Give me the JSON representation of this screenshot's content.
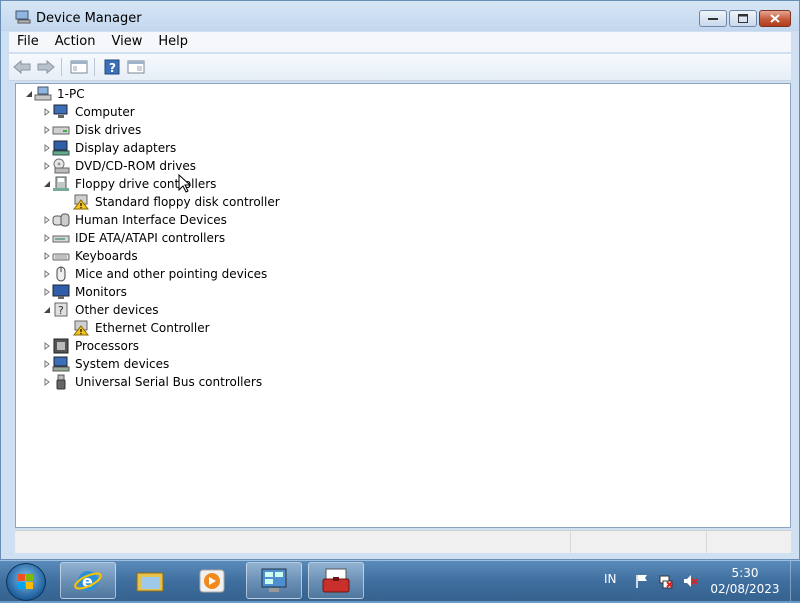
{
  "window": {
    "title": "Device Manager"
  },
  "menu": [
    "File",
    "Action",
    "View",
    "Help"
  ],
  "tree": {
    "root": "1-PC",
    "items": [
      {
        "label": "Computer",
        "icon": "computer-icon",
        "expanded": false
      },
      {
        "label": "Disk drives",
        "icon": "disk-drive-icon",
        "expanded": false
      },
      {
        "label": "Display adapters",
        "icon": "display-adapter-icon",
        "expanded": false
      },
      {
        "label": "DVD/CD-ROM drives",
        "icon": "dvd-drive-icon",
        "expanded": false
      },
      {
        "label": "Floppy drive controllers",
        "icon": "floppy-controller-icon",
        "expanded": true
      },
      {
        "label": "Standard floppy disk controller",
        "icon": "warning-device-icon",
        "child": true
      },
      {
        "label": "Human Interface Devices",
        "icon": "hid-icon",
        "expanded": false
      },
      {
        "label": "IDE ATA/ATAPI controllers",
        "icon": "ide-controller-icon",
        "expanded": false
      },
      {
        "label": "Keyboards",
        "icon": "keyboard-icon",
        "expanded": false
      },
      {
        "label": "Mice and other pointing devices",
        "icon": "mouse-icon",
        "expanded": false
      },
      {
        "label": "Monitors",
        "icon": "monitor-icon",
        "expanded": false
      },
      {
        "label": "Other devices",
        "icon": "other-devices-icon",
        "expanded": true
      },
      {
        "label": "Ethernet Controller",
        "icon": "warning-device-icon",
        "child": true
      },
      {
        "label": "Processors",
        "icon": "processor-icon",
        "expanded": false
      },
      {
        "label": "System devices",
        "icon": "system-devices-icon",
        "expanded": false
      },
      {
        "label": "Universal Serial Bus controllers",
        "icon": "usb-icon",
        "expanded": false
      }
    ]
  },
  "taskbar": {
    "apps": [
      "internet-explorer-icon",
      "windows-explorer-icon",
      "media-player-icon",
      "control-panel-icon",
      "device-manager-icon"
    ],
    "language": "IN",
    "time": "5:30",
    "date": "02/08/2023"
  },
  "colors": {
    "warning": "#f3c322",
    "accent": "#3f6f9f"
  }
}
